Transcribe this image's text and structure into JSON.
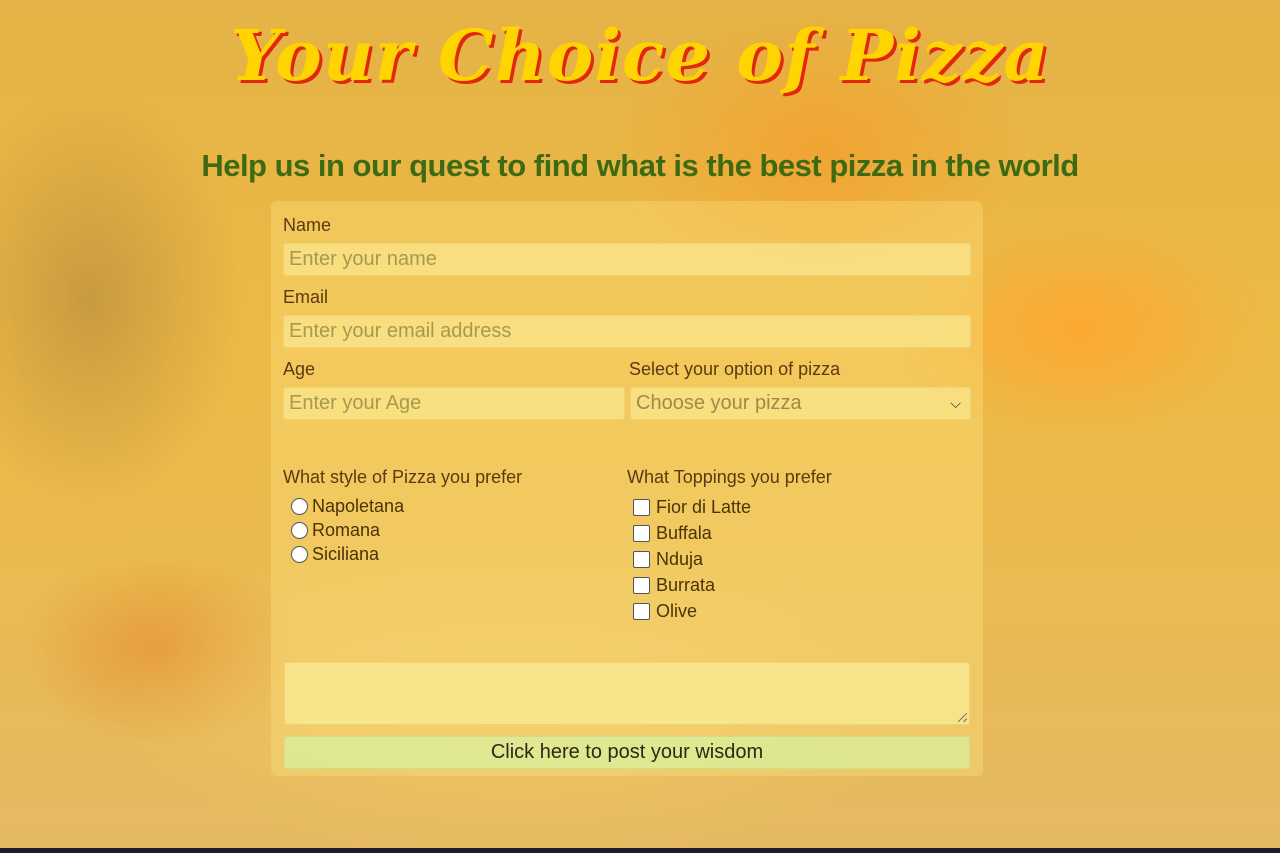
{
  "header": {
    "title": "Your Choice of Pizza",
    "subtitle": "Help us in our quest to find what is the best pizza in the world"
  },
  "form": {
    "name": {
      "label": "Name",
      "placeholder": "Enter your name"
    },
    "email": {
      "label": "Email",
      "placeholder": "Enter your email address"
    },
    "age": {
      "label": "Age",
      "placeholder": "Enter your Age"
    },
    "pizza_select": {
      "label": "Select your option of pizza",
      "selected": "Choose your pizza"
    },
    "style": {
      "label": "What style of Pizza you prefer",
      "options": [
        "Napoletana",
        "Romana",
        "Siciliana"
      ]
    },
    "toppings": {
      "label": "What Toppings you prefer",
      "options": [
        "Fior di Latte",
        "Buffala",
        "Nduja",
        "Burrata",
        "Olive"
      ]
    },
    "comments": {
      "value": ""
    },
    "submit_label": "Click here to post your wisdom"
  },
  "colors": {
    "title": "#ffd400",
    "title_shadow": "#e2280c",
    "subtitle": "#3d6a12",
    "label": "#5a3a10"
  },
  "icons": {
    "select_arrow": "chevron-down-icon"
  }
}
